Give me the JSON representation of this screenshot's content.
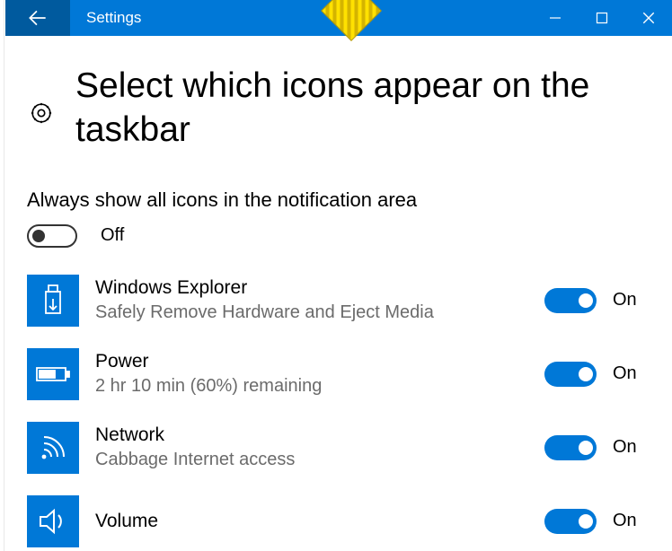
{
  "titlebar": {
    "title": "Settings"
  },
  "page": {
    "heading": "Select which icons appear on the taskbar",
    "master_label": "Always show all icons in the notification area",
    "master_state": "Off"
  },
  "items": [
    {
      "icon": "usb",
      "title": "Windows Explorer",
      "subtitle": "Safely Remove Hardware and Eject Media",
      "state": "On"
    },
    {
      "icon": "battery",
      "title": "Power",
      "subtitle": "2 hr 10 min (60%) remaining",
      "state": "On"
    },
    {
      "icon": "wifi",
      "title": "Network",
      "subtitle": "Cabbage Internet access",
      "state": "On"
    },
    {
      "icon": "volume",
      "title": "Volume",
      "subtitle": "",
      "state": "On"
    }
  ],
  "colors": {
    "accent": "#0078d7",
    "accent_dark": "#005a9e"
  }
}
